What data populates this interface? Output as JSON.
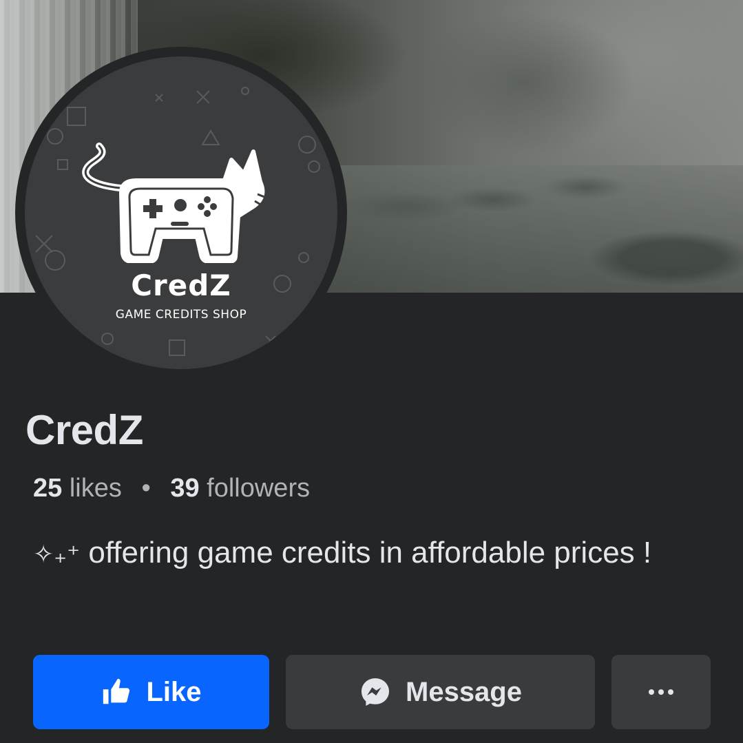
{
  "cover": {
    "alt_icon": "misty-lake-waterfall-photo"
  },
  "avatar": {
    "brand_title": "CredZ",
    "brand_subtitle": "GAME CREDITS SHOP",
    "logo_icon": "cat-gamepad-icon"
  },
  "page": {
    "name": "CredZ",
    "likes_count": "25",
    "likes_label": "likes",
    "separator": "•",
    "followers_count": "39",
    "followers_label": "followers",
    "bio_decoration": "✧₊⁺",
    "bio_text": "offering game credits in affordable prices !"
  },
  "actions": {
    "like_label": "Like",
    "like_icon": "thumbs-up-icon",
    "message_label": "Message",
    "message_icon": "messenger-icon",
    "more_label": "···",
    "more_icon": "more-dots-icon"
  },
  "colors": {
    "background": "#242526",
    "primary_button": "#0866ff",
    "secondary_button": "#3a3b3c",
    "text_primary": "#e4e6eb",
    "text_secondary": "#b0b3b8"
  }
}
